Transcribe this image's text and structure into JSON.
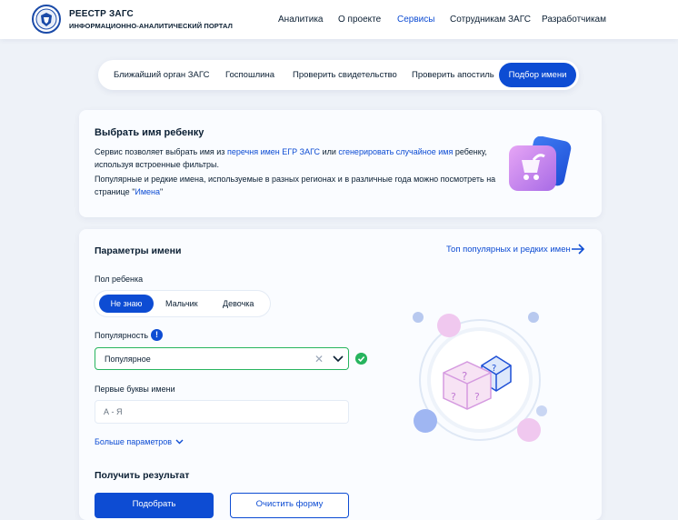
{
  "header": {
    "logo_title": "РЕЕСТР ЗАГС",
    "logo_subtitle": "ИНФОРМАЦИОННО-АНАЛИТИЧЕСКИЙ ПОРТАЛ",
    "nav": [
      "Аналитика",
      "О проекте",
      "Сервисы",
      "Сотрудникам ЗАГС",
      "Разработчикам"
    ],
    "active_nav": "Сервисы"
  },
  "tabs": {
    "items": [
      "Ближайший орган ЗАГС",
      "Госпошлина",
      "Проверить свидетельство",
      "Проверить апостиль",
      "Подбор имени"
    ],
    "active": "Подбор имени"
  },
  "intro": {
    "title": "Выбрать имя ребенку",
    "p1_a": "Сервис позволяет выбрать имя из ",
    "p1_link1": "перечня имен ЕГР ЗАГС",
    "p1_b": " или ",
    "p1_link2": "сгенерировать случайное имя",
    "p1_c": " ребенку,",
    "p1_line2": "используя встроенные фильтры.",
    "p2_line1": "Популярные и редкие имена, используемые в разных регионах и в различные года можно посмотреть на",
    "p2_a": "странице \"",
    "p2_link": "Имена",
    "p2_b": "\""
  },
  "params": {
    "title": "Параметры имени",
    "top_link": "Топ популярных и редких имен",
    "gender_label": "Пол ребенка",
    "gender_options": [
      "Не знаю",
      "Мальчик",
      "Девочка"
    ],
    "gender_selected": "Не знаю",
    "popularity_label": "Популярность",
    "popularity_value": "Популярное",
    "first_letters_label": "Первые буквы имени",
    "first_letters_placeholder": "А - Я",
    "more_params": "Больше параметров",
    "result_title": "Получить результат",
    "submit": "Подобрать",
    "clear": "Очистить форму"
  },
  "colors": {
    "accent": "#0d4cd3",
    "success": "#27b45e",
    "background": "#eef2f8"
  },
  "icons": [
    "emblem-icon",
    "stroller-icon",
    "arrow-right-icon",
    "info-icon",
    "clear-icon",
    "chevron-down-icon",
    "check-icon",
    "dice-icon"
  ]
}
